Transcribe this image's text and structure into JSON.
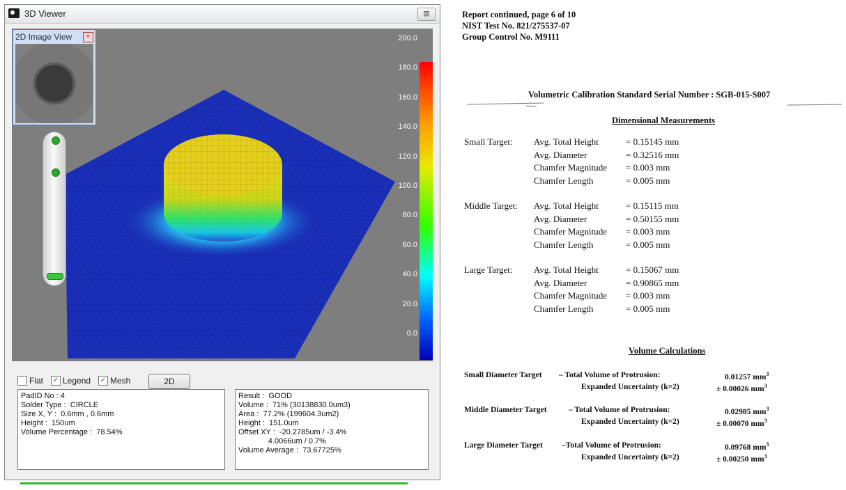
{
  "window": {
    "title": "3D Viewer",
    "close_label": "⊠",
    "mini_view_title": "2D Image View",
    "mini_close": "×"
  },
  "legend": {
    "ticks": [
      "200.0",
      "180.0",
      "160.0",
      "140.0",
      "120.0",
      "100.0",
      "80.0",
      "60.0",
      "40.0",
      "20.0",
      "0.0"
    ],
    "colors": {
      "high": "#ff0000",
      "mid": "#33ff00",
      "low": "#0000bb",
      "mesh_base": "#1a2fb8"
    }
  },
  "options": {
    "flat": {
      "label": "Flat",
      "checked": false
    },
    "legend": {
      "label": "Legend",
      "checked": true
    },
    "mesh": {
      "label": "Mesh",
      "checked": true
    },
    "button_2d": "2D"
  },
  "pad_info": [
    "PadID No : 4",
    "Solder Type :  CIRCLE",
    "Size X, Y :  0.6mm , 0.6mm",
    "Height :  150um",
    "Volume Percentage :  78.54%"
  ],
  "result_info": [
    "Result :  GOOD",
    "Volume :  71% (30138830.0um3)",
    "Area :  77.2% (199604.3um2)",
    "Height :  151.0um",
    "Offset XY :  -20.2785um / -3.4%",
    "              4.0066um / 0.7%",
    "Volume Average :  73.67725%"
  ],
  "report": {
    "header": [
      "Report continued, page 6 of 10",
      "NIST Test No. 821/275537-07",
      "Group Control No. M9111"
    ],
    "serial_line": "Volumetric Calibration Standard Serial Number : SGB-015-S007",
    "dimensional_title": "Dimensional Measurements",
    "targets": [
      {
        "name": "Small Target:",
        "rows": [
          [
            "Avg. Total Height",
            "= 0.15145 mm"
          ],
          [
            "Avg. Diameter",
            "= 0.32516 mm"
          ],
          [
            "Chamfer Magnitude",
            "= 0.003 mm"
          ],
          [
            "Chamfer Length",
            "= 0.005 mm"
          ]
        ]
      },
      {
        "name": "Middle Target:",
        "rows": [
          [
            "Avg. Total Height",
            "= 0.15115 mm"
          ],
          [
            "Avg. Diameter",
            "= 0.50155 mm"
          ],
          [
            "Chamfer Magnitude",
            "= 0.003 mm"
          ],
          [
            "Chamfer Length",
            "= 0.005 mm"
          ]
        ]
      },
      {
        "name": "Large Target:",
        "rows": [
          [
            "Avg. Total Height",
            "= 0.15067 mm"
          ],
          [
            "Avg. Diameter",
            "= 0.90865 mm"
          ],
          [
            "Chamfer Magnitude",
            "= 0.003 mm"
          ],
          [
            "Chamfer Length",
            "= 0.005 mm"
          ]
        ]
      }
    ],
    "volume_title": "Volume Calculations",
    "volumes": [
      {
        "target": "Small Diameter Target",
        "label1": "– Total Volume of Protrusion:",
        "value1": "0.01257 mm",
        "label2": "Expanded Uncertainty (k=2)",
        "value2": "± 0.00026 mm"
      },
      {
        "target": "Middle Diameter Target",
        "label1": "– Total Volume of Protrusion:",
        "value1": "0.02985 mm",
        "label2": "Expanded Uncertainty (k=2)",
        "value2": "± 0.00070 mm"
      },
      {
        "target": "Large Diameter Target",
        "label1": "–Total Volume of Protrusion:",
        "value1": "0.09768 mm",
        "label2": "Expanded Uncertainty (k=2)",
        "value2": "± 0.00250 mm"
      }
    ],
    "cube_sup": "3"
  }
}
